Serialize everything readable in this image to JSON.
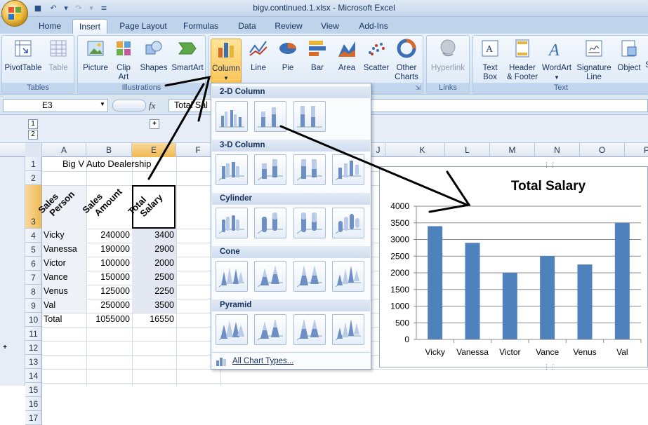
{
  "window": {
    "title": "bigv.continued.1.xlsx - Microsoft Excel"
  },
  "qat": {
    "save_icon": "save-icon",
    "undo_icon": "undo-icon",
    "redo_icon": "redo-icon",
    "customize_icon": "customize-icon"
  },
  "tabs": [
    "Home",
    "Insert",
    "Page Layout",
    "Formulas",
    "Data",
    "Review",
    "View",
    "Add-Ins"
  ],
  "ribbon": {
    "tables": {
      "label": "Tables",
      "pivot": "PivotTable",
      "table": "Table"
    },
    "illustrations": {
      "label": "Illustrations",
      "picture": "Picture",
      "clip1": "Clip",
      "clip2": "Art",
      "shapes": "Shapes",
      "smartart": "SmartArt"
    },
    "charts": {
      "column": "Column",
      "line": "Line",
      "pie": "Pie",
      "bar": "Bar",
      "area": "Area",
      "scatter": "Scatter",
      "other1": "Other",
      "other2": "Charts"
    },
    "links": {
      "label": "Links",
      "hyperlink": "Hyperlink"
    },
    "text": {
      "label": "Text",
      "textbox1": "Text",
      "textbox2": "Box",
      "header1": "Header",
      "header2": "& Footer",
      "wordart": "WordArt",
      "signature1": "Signature",
      "signature2": "Line",
      "object": "Object",
      "symbol": "S"
    }
  },
  "formula": {
    "namebox": "E3",
    "fx": "fx",
    "content": "Total Sal"
  },
  "outline": {
    "level1": "1",
    "level2": "2",
    "rowlevel1": "1",
    "rowlevel2": "2",
    "expand": "+",
    "expand_row": "+"
  },
  "columns": [
    "A",
    "B",
    "E",
    "F",
    "J",
    "K",
    "L",
    "M",
    "N",
    "O",
    "P"
  ],
  "rows": [
    "1",
    "2",
    "3",
    "4",
    "5",
    "6",
    "7",
    "8",
    "9",
    "10",
    "11",
    "12",
    "13",
    "14",
    "15",
    "16",
    "17"
  ],
  "sheet": {
    "title": "Big V Auto Dealership",
    "header_a1": "Sales",
    "header_a2": "Person",
    "header_b1": "Sales",
    "header_b2": "Amount",
    "header_e1": "Total",
    "header_e2": "Salary",
    "data": [
      {
        "name": "Vicky",
        "amount": "240000",
        "salary": "3400"
      },
      {
        "name": "Vanessa",
        "amount": "190000",
        "salary": "2900"
      },
      {
        "name": "Victor",
        "amount": "100000",
        "salary": "2000"
      },
      {
        "name": "Vance",
        "amount": "150000",
        "salary": "2500"
      },
      {
        "name": "Venus",
        "amount": "125000",
        "salary": "2250"
      },
      {
        "name": "Val",
        "amount": "250000",
        "salary": "3500"
      }
    ],
    "total": {
      "label": "Total",
      "amount": "1055000",
      "salary": "16550"
    }
  },
  "dropdown": {
    "sections": [
      "2-D Column",
      "3-D Column",
      "Cylinder",
      "Cone",
      "Pyramid"
    ],
    "all_types": "All Chart Types..."
  },
  "chart_data": {
    "type": "bar",
    "title": "Total Salary",
    "categories": [
      "Vicky",
      "Vanessa",
      "Victor",
      "Vance",
      "Venus",
      "Val"
    ],
    "values": [
      3400,
      2900,
      2000,
      2500,
      2250,
      3500
    ],
    "ylim": [
      0,
      4000
    ],
    "yticks": [
      "4000",
      "3500",
      "3000",
      "2500",
      "2000",
      "1500",
      "1000",
      "500",
      "0"
    ],
    "grid": true,
    "color": "#4f81bd"
  },
  "colors": {
    "accent": "#4f81bd",
    "selected_tab": "#ffffff",
    "ribbon": "#d6e5f5"
  }
}
